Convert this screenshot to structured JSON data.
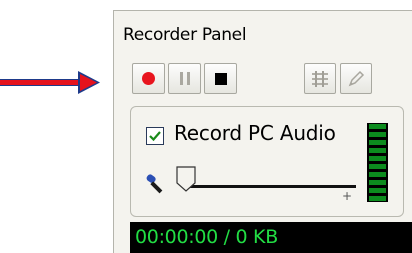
{
  "annotation": {
    "arrow_color": "#e5121c"
  },
  "panel": {
    "title": "Recorder Panel",
    "toolbar": {
      "record_icon": "record-icon",
      "pause_icon": "pause-icon",
      "stop_icon": "stop-icon",
      "extra_icons": [
        "equalizer-icon",
        "pen-icon"
      ]
    },
    "record_pc_audio": {
      "label": "Record PC Audio",
      "checked": true
    },
    "level_indicator": "green",
    "status": "00:00:00 / 0 KB"
  }
}
